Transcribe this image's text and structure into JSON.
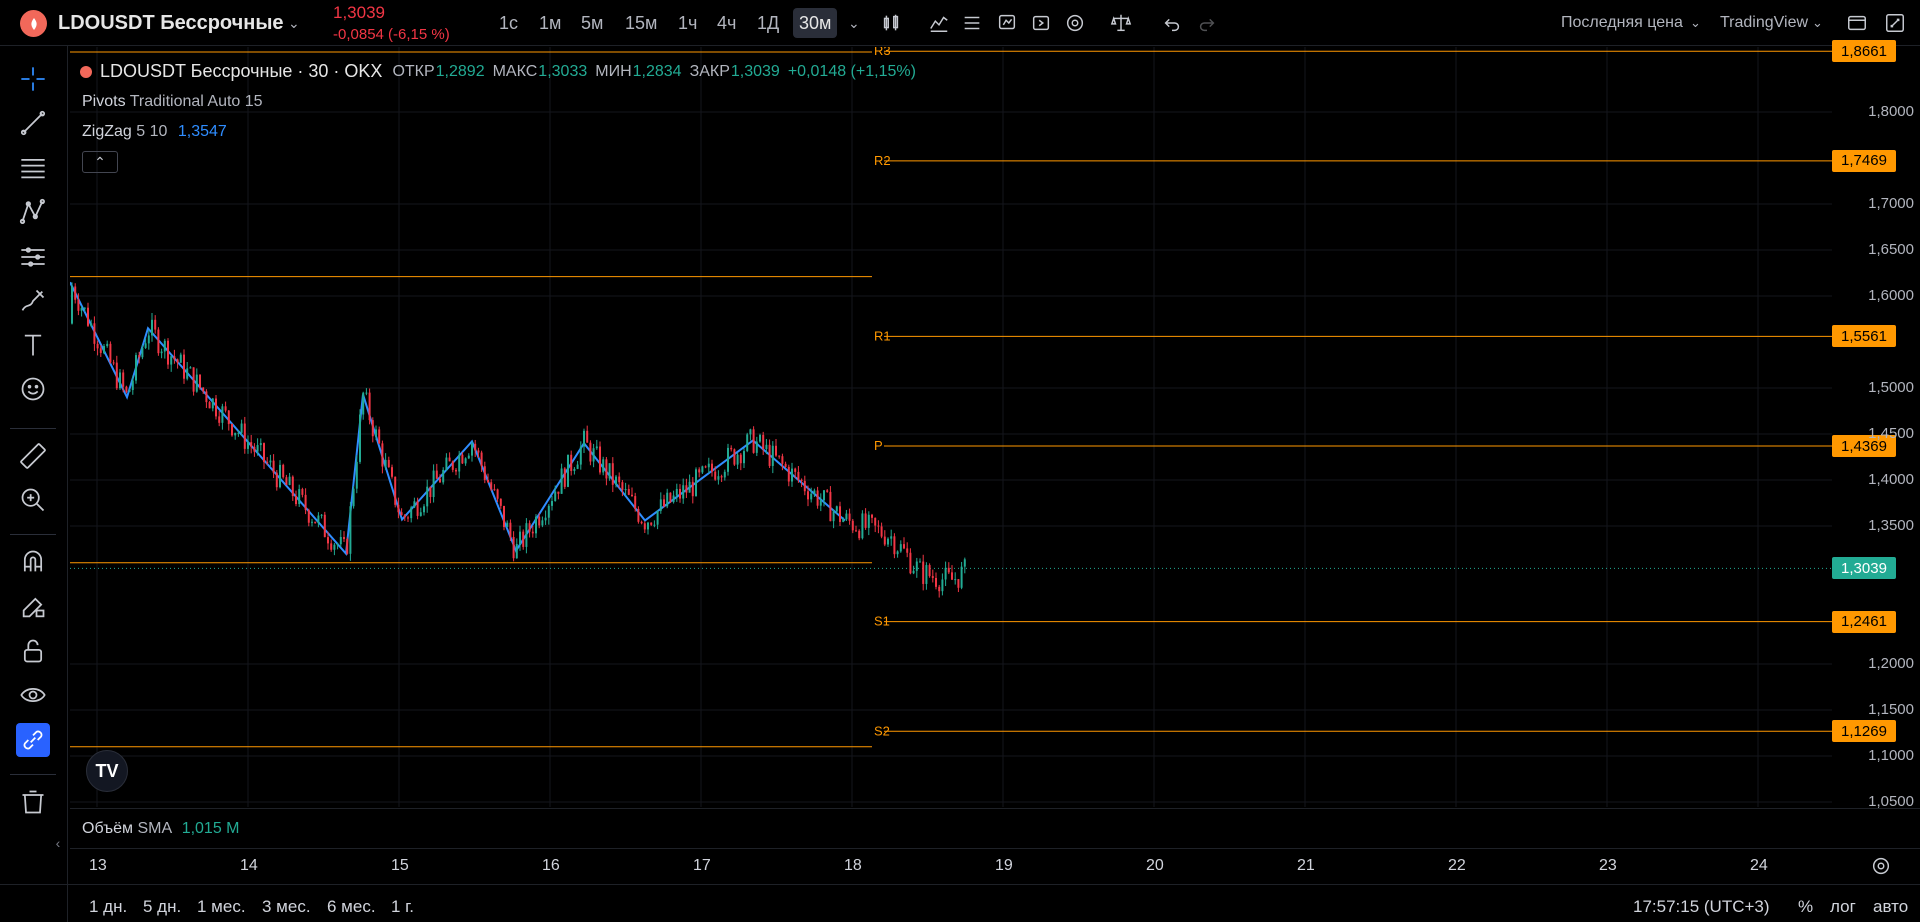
{
  "header": {
    "symbol": "LDOUSDT Бессрочные",
    "last_price": "1,3039",
    "price_change": "-0,0854 (-6,15 %)",
    "timeframes": [
      "1с",
      "1м",
      "5м",
      "15м",
      "1ч",
      "4ч",
      "1Д",
      "30м"
    ],
    "active_timeframe": "30м",
    "price_type": "Последняя цена",
    "provider": "TradingView"
  },
  "legend": {
    "title": "LDOUSDT Бессрочные · 30 · OKX",
    "open_label": "ОТКР",
    "open": "1,2892",
    "high_label": "МАКС",
    "high": "1,3033",
    "low_label": "МИН",
    "low": "1,2834",
    "close_label": "ЗАКР",
    "close": "1,3039",
    "change": "+0,0148 (+1,15%)"
  },
  "indicators": {
    "pivots_name": "Pivots",
    "pivots_params": "Traditional Auto 15",
    "zigzag_name": "ZigZag",
    "zigzag_params": "5 10",
    "zigzag_value": "1,3547",
    "volume_name": "Объём",
    "volume_sma": "SMA",
    "volume_value": "1,015 M"
  },
  "pivot_levels": [
    {
      "name": "R3",
      "value": "1,8661",
      "price": 1.8661
    },
    {
      "name": "R2",
      "value": "1,7469",
      "price": 1.7469
    },
    {
      "name": "R1",
      "value": "1,5561",
      "price": 1.5561
    },
    {
      "name": "P",
      "value": "1,4369",
      "price": 1.4369
    },
    {
      "name": "S1",
      "value": "1,2461",
      "price": 1.2461
    },
    {
      "name": "S2",
      "value": "1,1269",
      "price": 1.1269
    }
  ],
  "current_price_tag": "1,3039",
  "price_axis_ticks": [
    "1,8000",
    "1,7000",
    "1,6500",
    "1,6000",
    "1,5000",
    "1,4500",
    "1,4000",
    "1,3500",
    "1,2000",
    "1,1500",
    "1,1000",
    "1,0500"
  ],
  "time_axis_ticks": [
    "13",
    "14",
    "15",
    "16",
    "17",
    "18",
    "19",
    "20",
    "21",
    "22",
    "23",
    "24"
  ],
  "bottom": {
    "ranges": [
      "1 дн.",
      "5 дн.",
      "1 мес.",
      "3 мес.",
      "6 мес.",
      "1 г."
    ],
    "clock": "17:57:15 (UTC+3)",
    "percent": "%",
    "log": "лог",
    "auto": "авто"
  },
  "colors": {
    "up": "#22ab94",
    "down": "#f23645",
    "pivot": "#ff9800",
    "zigzag": "#2f8dff",
    "accent": "#2962ff"
  },
  "chart_data": {
    "type": "candlestick",
    "x": [
      "13",
      "14",
      "15",
      "16",
      "17",
      "18"
    ],
    "zigzag": [
      1.615,
      1.49,
      1.565,
      1.32,
      1.493,
      1.357,
      1.442,
      1.323,
      1.44,
      1.356,
      1.443,
      1.356
    ],
    "ylim": [
      1.05,
      1.866
    ],
    "last": 1.3039
  }
}
